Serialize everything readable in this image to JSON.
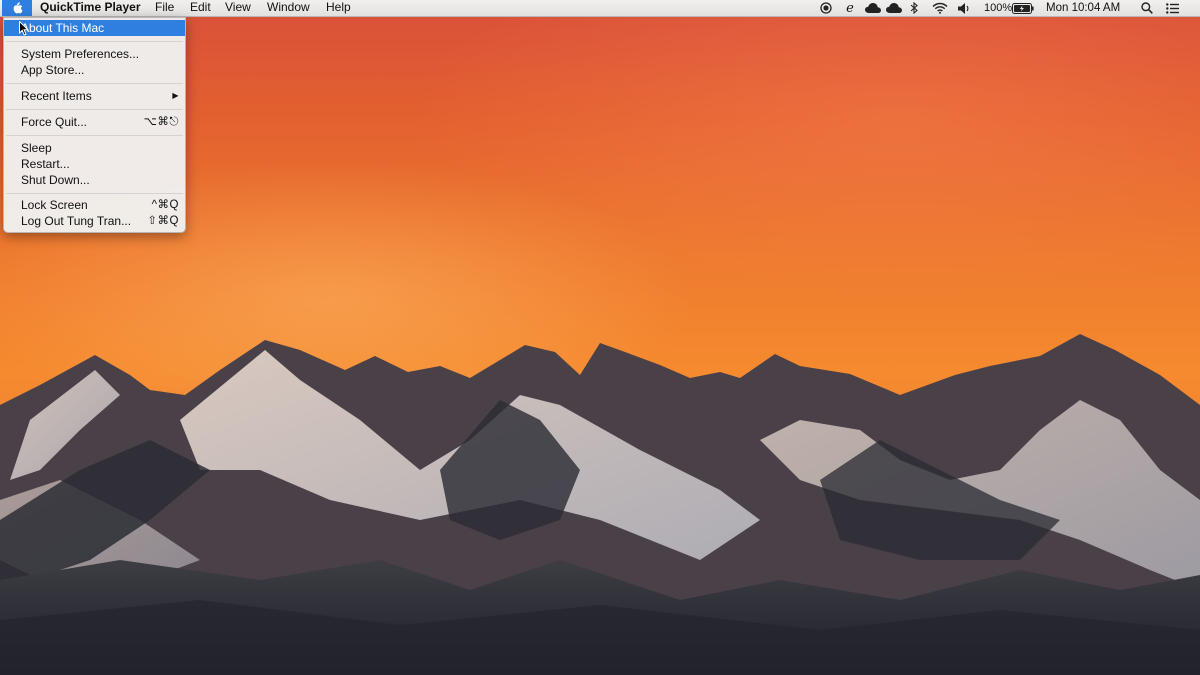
{
  "menubar": {
    "app_name": "QuickTime Player",
    "menus": [
      "File",
      "Edit",
      "View",
      "Window",
      "Help"
    ],
    "status": {
      "battery_percent": "100%",
      "clock": "Mon 10:04 AM",
      "icons": [
        "screen-record-icon",
        "edge-icon",
        "cloud-icon",
        "cloud-icon",
        "bluetooth-icon",
        "wifi-icon",
        "volume-icon",
        "battery-icon",
        "spotlight-icon",
        "notification-center-icon"
      ]
    }
  },
  "apple_menu": {
    "items": [
      {
        "label": "About This Mac",
        "shortcut": "",
        "selected": true
      },
      {
        "label": "System Preferences...",
        "shortcut": ""
      },
      {
        "label": "App Store...",
        "shortcut": ""
      },
      {
        "label": "Recent Items",
        "shortcut": "▶"
      },
      {
        "label": "Force Quit...",
        "shortcut": "⌥⌘⎋"
      },
      {
        "label": "Sleep",
        "shortcut": ""
      },
      {
        "label": "Restart...",
        "shortcut": ""
      },
      {
        "label": "Shut Down...",
        "shortcut": ""
      },
      {
        "label": "Lock Screen",
        "shortcut": "^⌘Q"
      },
      {
        "label": "Log Out Tung Tran...",
        "shortcut": "⇧⌘Q"
      }
    ]
  },
  "colors": {
    "selection": "#2f7fe0",
    "sky": "#ee7a2e",
    "menubar": "#ebe9e7"
  }
}
